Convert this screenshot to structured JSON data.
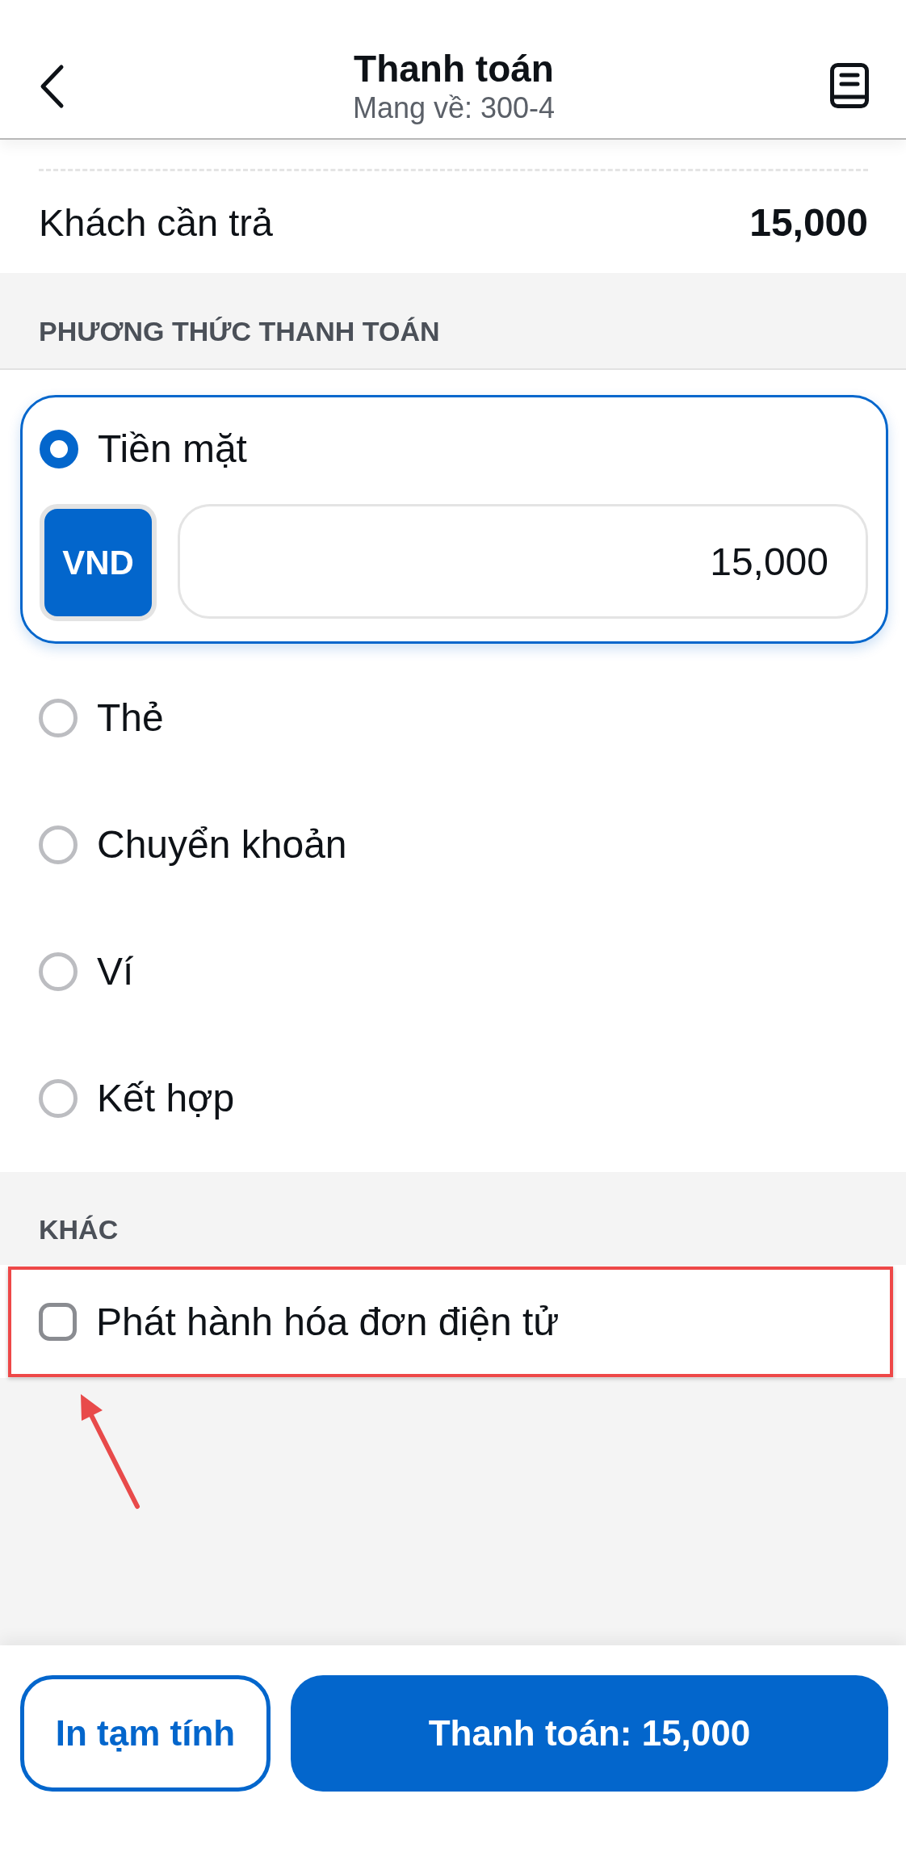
{
  "header": {
    "title": "Thanh toán",
    "subtitle": "Mang về: 300-4"
  },
  "summary": {
    "label": "Khách cần trả",
    "amount": "15,000"
  },
  "payment": {
    "heading": "PHƯƠNG THỨC THANH TOÁN",
    "methods": [
      {
        "label": "Tiền mặt",
        "selected": true,
        "currency": "VND",
        "amount": "15,000"
      },
      {
        "label": "Thẻ",
        "selected": false
      },
      {
        "label": "Chuyển khoản",
        "selected": false
      },
      {
        "label": "Ví",
        "selected": false
      },
      {
        "label": "Kết hợp",
        "selected": false
      }
    ]
  },
  "other": {
    "heading": "KHÁC",
    "options": [
      {
        "label": "Phát hành hóa đơn điện tử",
        "checked": false,
        "highlighted": true
      }
    ]
  },
  "footer": {
    "buttons": [
      {
        "label": "In tạm tính",
        "kind": "outline"
      },
      {
        "label": "Thanh toán: 15,000",
        "kind": "primary"
      }
    ]
  }
}
